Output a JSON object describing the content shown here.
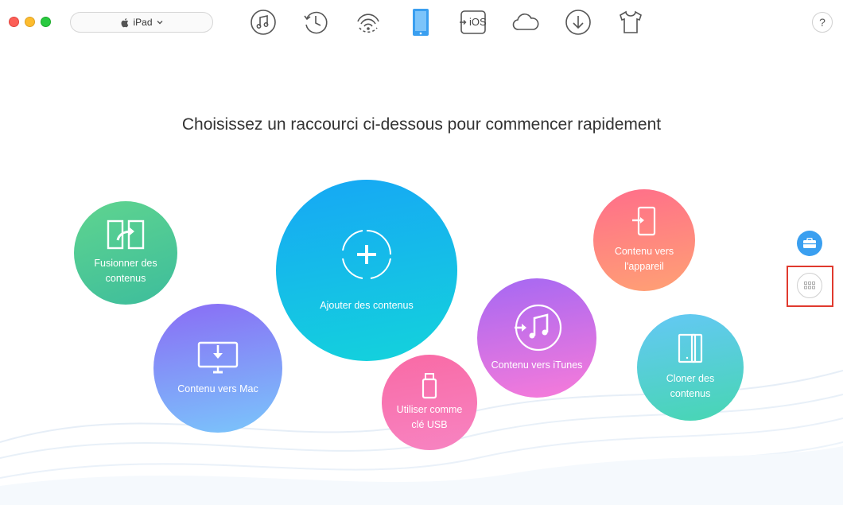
{
  "window": {
    "device_selector": {
      "label": "iPad",
      "icon": "apple-icon"
    }
  },
  "toolbar": {
    "items": [
      {
        "name": "music-icon",
        "label": ""
      },
      {
        "name": "history-icon",
        "label": ""
      },
      {
        "name": "wifi-icon",
        "label": ""
      },
      {
        "name": "device-icon",
        "label": "",
        "active": true
      },
      {
        "name": "ios-mover-icon",
        "label": "iOS"
      },
      {
        "name": "icloud-icon",
        "label": ""
      },
      {
        "name": "download-icon",
        "label": ""
      },
      {
        "name": "shirt-icon",
        "label": ""
      }
    ],
    "help_label": "?"
  },
  "main": {
    "heading": "Choisissez un raccourci ci-dessous pour commencer rapidement",
    "shortcuts": {
      "merge": "Fusionner des contenus",
      "to_mac": "Contenu vers Mac",
      "add": "Ajouter des contenus",
      "usb": "Utiliser comme clé USB",
      "to_itunes": "Contenu vers iTunes",
      "to_device": "Contenu vers l'appareil",
      "clone": "Cloner des contenus"
    }
  },
  "colors": {
    "active_device": "#3a9ff0",
    "highlight": "#e03a2e"
  }
}
